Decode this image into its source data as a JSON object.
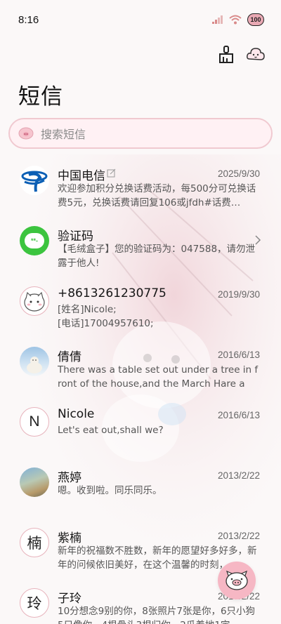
{
  "status_bar": {
    "time": "8:16",
    "battery": "100"
  },
  "header": {
    "title": "短信"
  },
  "search": {
    "placeholder": "搜索短信"
  },
  "messages": [
    {
      "name": "中国电信",
      "date": "2025/9/30",
      "preview": "欢迎参加积分兑换话费活动，每500分可兑换话费5元，兑换话费请回复106或jfdh#话费…",
      "avatar": "china-telecom-logo"
    },
    {
      "name": "验证码",
      "date": "",
      "preview": "【毛绒盒子】您的验证码为：047588，请勿泄露于他人!",
      "avatar": "verification-icon",
      "avatar_text": "**-"
    },
    {
      "name": "+8613261230775",
      "date": "2019/9/30",
      "preview": "[姓名]Nicole;\n[电话]17004957610;",
      "avatar": "cartoon-cat-avatar"
    },
    {
      "name": "倩倩",
      "date": "2016/6/13",
      "preview": "There was a table set out under a tree in front of the house,and the March Hare an…",
      "avatar": "photo-avatar-polar-bear"
    },
    {
      "name": "Nicole",
      "date": "2016/6/13",
      "preview": "Let's eat out,shall we?",
      "avatar": "letter-avatar",
      "avatar_text": "N"
    },
    {
      "name": "燕婷",
      "date": "2013/2/22",
      "preview": "嗯。收到啦。同乐同乐。",
      "avatar": "photo-avatar-landscape"
    },
    {
      "name": "紫楠",
      "date": "2013/2/22",
      "preview": "新年的祝福数不胜数，新年的愿望好多好多，新年的问候依旧美好，在这个温馨的时刻，…",
      "avatar": "letter-avatar",
      "avatar_text": "楠"
    },
    {
      "name": "子玲",
      "date": "2013/2/22",
      "preview": "10分想念9别的你，8张照片7张是你，6只小狗5只像你，4根骨头3根归你，2瓜着地1定…",
      "avatar": "letter-avatar",
      "avatar_text": "玲"
    }
  ],
  "colors": {
    "accent_pink": "#f6b7c4",
    "search_border": "#f0c9d0",
    "telecom_blue": "#0b5fb5",
    "verify_green": "#3cc43f"
  }
}
